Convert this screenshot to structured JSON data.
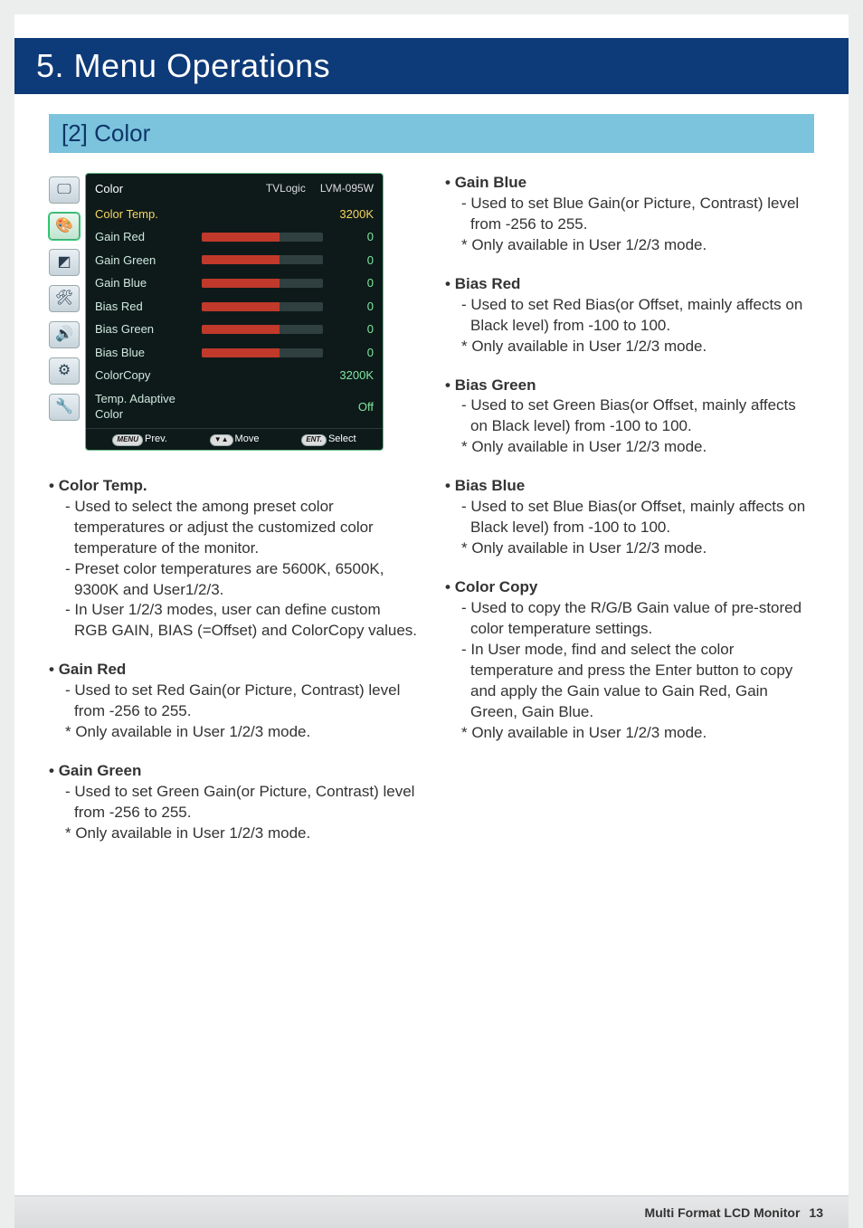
{
  "chapter": "5. Menu Operations",
  "section": "[2] Color",
  "osd": {
    "title": "Color",
    "brand": "TVLogic",
    "model": "LVM-095W",
    "rows": [
      {
        "label": "Color Temp.",
        "value": "3200K",
        "slider": false,
        "hl": true
      },
      {
        "label": "Gain Red",
        "value": "0",
        "slider": true
      },
      {
        "label": "Gain Green",
        "value": "0",
        "slider": true
      },
      {
        "label": "Gain Blue",
        "value": "0",
        "slider": true
      },
      {
        "label": "Bias Red",
        "value": "0",
        "slider": true
      },
      {
        "label": "Bias Green",
        "value": "0",
        "slider": true
      },
      {
        "label": "Bias Blue",
        "value": "0",
        "slider": true
      },
      {
        "label": "ColorCopy",
        "value": "3200K",
        "slider": false
      },
      {
        "label": "Temp. Adaptive Color",
        "value": "Off",
        "slider": false
      }
    ],
    "foot": {
      "prev_pill": "MENU",
      "prev": "Prev.",
      "move_pill": "▼▲",
      "move": "Move",
      "select_pill": "ENT.",
      "select": "Select"
    },
    "icons": [
      "monitor-icon",
      "palette-icon",
      "marker-icon",
      "tools-icon",
      "audio-icon",
      "gpi-icon",
      "system-icon"
    ]
  },
  "left_items": [
    {
      "title": "Color Temp.",
      "lines": [
        "- Used to select the among preset color temperatures or adjust the customized color temperature of the monitor.",
        "- Preset color temperatures are 5600K, 6500K, 9300K and User1/2/3.",
        "- In User 1/2/3 modes, user can define custom RGB GAIN, BIAS (=Offset) and ColorCopy values."
      ]
    },
    {
      "title": "Gain Red",
      "lines": [
        "- Used to set Red Gain(or Picture, Contrast) level from -256 to 255.",
        "* Only available in User 1/2/3 mode."
      ]
    },
    {
      "title": "Gain Green",
      "lines": [
        "- Used to set Green Gain(or Picture, Contrast) level from -256 to 255.",
        "* Only available in User 1/2/3 mode."
      ]
    }
  ],
  "right_items": [
    {
      "title": "Gain Blue",
      "lines": [
        "- Used to set Blue Gain(or Picture, Contrast) level from -256 to 255.",
        "* Only available in User 1/2/3 mode."
      ]
    },
    {
      "title": "Bias Red",
      "lines": [
        "- Used to set Red Bias(or Offset, mainly affects on Black level) from -100 to 100.",
        "* Only available in User 1/2/3 mode."
      ]
    },
    {
      "title": "Bias Green",
      "lines": [
        "- Used to set Green Bias(or Offset, mainly affects on Black level) from -100 to 100.",
        "* Only available in User 1/2/3 mode."
      ]
    },
    {
      "title": "Bias Blue",
      "lines": [
        "- Used to set Blue Bias(or Offset, mainly affects on Black level) from -100 to 100.",
        "* Only available in User 1/2/3 mode."
      ]
    },
    {
      "title": "Color Copy",
      "lines": [
        "- Used to copy the R/G/B Gain value of pre-stored color temperature settings.",
        "- In User mode, find and select the color temperature and press the Enter button to copy and apply the Gain value to Gain Red, Gain Green, Gain Blue.",
        "* Only available in User 1/2/3 mode."
      ]
    }
  ],
  "footer": {
    "title": "Multi Format LCD Monitor",
    "page": "13"
  }
}
